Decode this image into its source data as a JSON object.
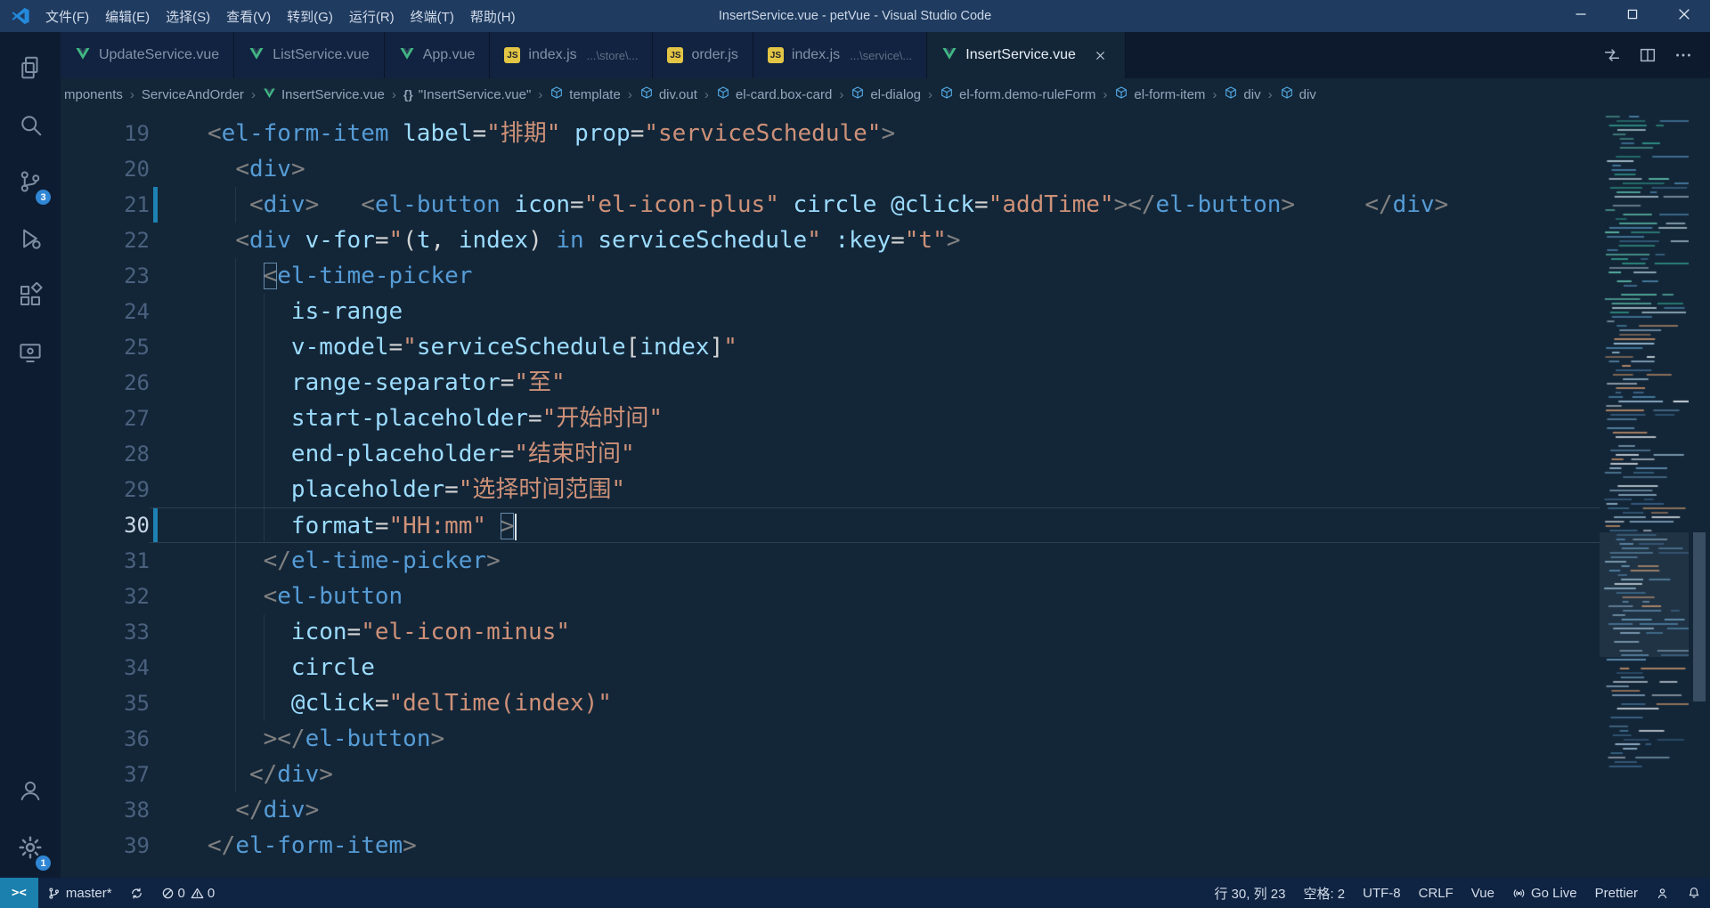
{
  "title_bar": {
    "title": "InsertService.vue - petVue - Visual Studio Code",
    "menus": [
      "文件(F)",
      "编辑(E)",
      "选择(S)",
      "查看(V)",
      "转到(G)",
      "运行(R)",
      "终端(T)",
      "帮助(H)"
    ],
    "window_controls": [
      {
        "name": "minimize-button",
        "icon": "minimize"
      },
      {
        "name": "maximize-button",
        "icon": "maximize"
      },
      {
        "name": "close-button",
        "icon": "close"
      }
    ]
  },
  "activity_bar": {
    "top": [
      {
        "name": "explorer",
        "icon": "explorer"
      },
      {
        "name": "search",
        "icon": "search"
      },
      {
        "name": "source-control",
        "icon": "scm",
        "badge": "3"
      },
      {
        "name": "run-debug",
        "icon": "debug"
      },
      {
        "name": "extensions",
        "icon": "extensions"
      },
      {
        "name": "remote-explorer",
        "icon": "remote"
      }
    ],
    "bottom": [
      {
        "name": "account",
        "icon": "account"
      },
      {
        "name": "settings",
        "icon": "gear",
        "badge": "1"
      }
    ]
  },
  "tabs": [
    {
      "label": "UpdateService.vue",
      "icon": "vue",
      "active": false
    },
    {
      "label": "ListService.vue",
      "icon": "vue",
      "active": false
    },
    {
      "label": "App.vue",
      "icon": "vue",
      "active": false
    },
    {
      "label": "index.js",
      "desc": "...\\store\\...",
      "icon": "js",
      "active": false
    },
    {
      "label": "order.js",
      "icon": "js",
      "active": false
    },
    {
      "label": "index.js",
      "desc": "...\\service\\...",
      "icon": "js",
      "active": false
    },
    {
      "label": "InsertService.vue",
      "icon": "vue",
      "active": true,
      "close": true
    }
  ],
  "tab_actions": [
    {
      "name": "open-changes-icon",
      "icon": "openchanges"
    },
    {
      "name": "split-editor-icon",
      "icon": "split"
    },
    {
      "name": "more-actions-icon",
      "icon": "ellipsis"
    }
  ],
  "breadcrumbs": [
    {
      "label": "mponents",
      "icon": null
    },
    {
      "label": "ServiceAndOrder",
      "icon": null
    },
    {
      "label": "InsertService.vue",
      "icon": "vue"
    },
    {
      "label": "\"InsertService.vue\"",
      "icon": "braces"
    },
    {
      "label": "template",
      "icon": "symbol"
    },
    {
      "label": "div.out",
      "icon": "symbol"
    },
    {
      "label": "el-card.box-card",
      "icon": "symbol"
    },
    {
      "label": "el-dialog",
      "icon": "symbol"
    },
    {
      "label": "el-form.demo-ruleForm",
      "icon": "symbol"
    },
    {
      "label": "el-form-item",
      "icon": "symbol"
    },
    {
      "label": "div",
      "icon": "symbol"
    },
    {
      "label": "div",
      "icon": "symbol"
    }
  ],
  "editor": {
    "lines": [
      {
        "num": 19,
        "indent": 0,
        "tokens": [
          [
            "p",
            "<"
          ],
          [
            "t",
            "el-form-item"
          ],
          [
            "w",
            " "
          ],
          [
            "a",
            "label"
          ],
          [
            "o",
            "="
          ],
          [
            "s",
            "\"排期\""
          ],
          [
            "w",
            " "
          ],
          [
            "a",
            "prop"
          ],
          [
            "o",
            "="
          ],
          [
            "s",
            "\"serviceSchedule\""
          ],
          [
            "p",
            ">"
          ]
        ]
      },
      {
        "num": 20,
        "indent": 2,
        "tokens": [
          [
            "p",
            "<"
          ],
          [
            "t",
            "div"
          ],
          [
            "p",
            ">"
          ]
        ]
      },
      {
        "num": 21,
        "indent": 3,
        "modified": true,
        "tokens": [
          [
            "p",
            "<"
          ],
          [
            "t",
            "div"
          ],
          [
            "p",
            ">"
          ],
          [
            "w",
            "   "
          ],
          [
            "p",
            "<"
          ],
          [
            "t",
            "el-button"
          ],
          [
            "w",
            " "
          ],
          [
            "a",
            "icon"
          ],
          [
            "o",
            "="
          ],
          [
            "s",
            "\"el-icon-plus\""
          ],
          [
            "w",
            " "
          ],
          [
            "a",
            "circle"
          ],
          [
            "w",
            " "
          ],
          [
            "a",
            "@click"
          ],
          [
            "o",
            "="
          ],
          [
            "s",
            "\"addTime\""
          ],
          [
            "p",
            "></"
          ],
          [
            "t",
            "el-button"
          ],
          [
            "p",
            ">"
          ],
          [
            "w",
            "     "
          ],
          [
            "p",
            "</"
          ],
          [
            "t",
            "div"
          ],
          [
            "p",
            ">"
          ]
        ]
      },
      {
        "num": 22,
        "indent": 2,
        "tokens": [
          [
            "p",
            "<"
          ],
          [
            "t",
            "div"
          ],
          [
            "w",
            " "
          ],
          [
            "a",
            "v-for"
          ],
          [
            "o",
            "="
          ],
          [
            "s",
            "\""
          ],
          [
            "w",
            "("
          ],
          [
            "a",
            "t"
          ],
          [
            "w",
            ", "
          ],
          [
            "a",
            "index"
          ],
          [
            "w",
            ") "
          ],
          [
            "k",
            "in"
          ],
          [
            "w",
            " "
          ],
          [
            "a",
            "serviceSchedule"
          ],
          [
            "s",
            "\""
          ],
          [
            "w",
            " "
          ],
          [
            "a",
            ":key"
          ],
          [
            "o",
            "="
          ],
          [
            "s",
            "\"t\""
          ],
          [
            "p",
            ">"
          ]
        ]
      },
      {
        "num": 23,
        "indent": 4,
        "tokens": [
          [
            "pm",
            "<"
          ],
          [
            "t",
            "el-time-picker"
          ]
        ]
      },
      {
        "num": 24,
        "indent": 6,
        "tokens": [
          [
            "a",
            "is-range"
          ]
        ]
      },
      {
        "num": 25,
        "indent": 6,
        "tokens": [
          [
            "a",
            "v-model"
          ],
          [
            "o",
            "="
          ],
          [
            "s",
            "\""
          ],
          [
            "a",
            "serviceSchedule"
          ],
          [
            "w",
            "["
          ],
          [
            "a",
            "index"
          ],
          [
            "w",
            "]"
          ],
          [
            "s",
            "\""
          ]
        ]
      },
      {
        "num": 26,
        "indent": 6,
        "tokens": [
          [
            "a",
            "range-separator"
          ],
          [
            "o",
            "="
          ],
          [
            "s",
            "\"至\""
          ]
        ]
      },
      {
        "num": 27,
        "indent": 6,
        "tokens": [
          [
            "a",
            "start-placeholder"
          ],
          [
            "o",
            "="
          ],
          [
            "s",
            "\"开始时间\""
          ]
        ]
      },
      {
        "num": 28,
        "indent": 6,
        "tokens": [
          [
            "a",
            "end-placeholder"
          ],
          [
            "o",
            "="
          ],
          [
            "s",
            "\"结束时间\""
          ]
        ]
      },
      {
        "num": 29,
        "indent": 6,
        "tokens": [
          [
            "a",
            "placeholder"
          ],
          [
            "o",
            "="
          ],
          [
            "s",
            "\"选择时间范围\""
          ]
        ]
      },
      {
        "num": 30,
        "indent": 6,
        "current": true,
        "modified": true,
        "cursor": true,
        "tokens": [
          [
            "a",
            "format"
          ],
          [
            "o",
            "="
          ],
          [
            "s",
            "\"HH:mm\""
          ],
          [
            "w",
            " "
          ],
          [
            "pm",
            ">"
          ]
        ]
      },
      {
        "num": 31,
        "indent": 4,
        "tokens": [
          [
            "p",
            "</"
          ],
          [
            "t",
            "el-time-picker"
          ],
          [
            "p",
            ">"
          ]
        ]
      },
      {
        "num": 32,
        "indent": 4,
        "tokens": [
          [
            "p",
            "<"
          ],
          [
            "t",
            "el-button"
          ]
        ]
      },
      {
        "num": 33,
        "indent": 6,
        "tokens": [
          [
            "a",
            "icon"
          ],
          [
            "o",
            "="
          ],
          [
            "s",
            "\"el-icon-minus\""
          ]
        ]
      },
      {
        "num": 34,
        "indent": 6,
        "tokens": [
          [
            "a",
            "circle"
          ]
        ]
      },
      {
        "num": 35,
        "indent": 6,
        "tokens": [
          [
            "a",
            "@click"
          ],
          [
            "o",
            "="
          ],
          [
            "s",
            "\"delTime(index)\""
          ]
        ]
      },
      {
        "num": 36,
        "indent": 4,
        "tokens": [
          [
            "p",
            "></"
          ],
          [
            "t",
            "el-button"
          ],
          [
            "p",
            ">"
          ]
        ]
      },
      {
        "num": 37,
        "indent": 3,
        "tokens": [
          [
            "p",
            "</"
          ],
          [
            "t",
            "div"
          ],
          [
            "p",
            ">"
          ]
        ]
      },
      {
        "num": 38,
        "indent": 2,
        "tokens": [
          [
            "p",
            "</"
          ],
          [
            "t",
            "div"
          ],
          [
            "p",
            ">"
          ]
        ]
      },
      {
        "num": 39,
        "indent": 0,
        "tokens": [
          [
            "p",
            "</"
          ],
          [
            "t",
            "el-form-item"
          ],
          [
            "p",
            ">"
          ]
        ]
      }
    ]
  },
  "status_bar": {
    "remote_glyph": "><",
    "branch": "master*",
    "problems": {
      "errors": "0",
      "warnings": "0"
    },
    "right": [
      {
        "name": "cursor-position",
        "label": "行 30, 列 23"
      },
      {
        "name": "indentation",
        "label": "空格: 2"
      },
      {
        "name": "encoding",
        "label": "UTF-8"
      },
      {
        "name": "eol",
        "label": "CRLF"
      },
      {
        "name": "language-mode",
        "label": "Vue"
      },
      {
        "name": "go-live",
        "icon": "broadcast",
        "label": "Go Live"
      },
      {
        "name": "prettier",
        "label": "Prettier"
      },
      {
        "name": "feedback",
        "icon": "feedback",
        "label": ""
      },
      {
        "name": "notifications",
        "icon": "bell",
        "label": ""
      }
    ]
  },
  "colors": {
    "accent": "#2f86d4",
    "titlebar": "#1f3b60",
    "editor_bg": "#132638",
    "remote_bg": "#1b80ad",
    "tag": "#569cd6",
    "attribute": "#9cdcfe",
    "string": "#ce9178",
    "punctuation": "#808080"
  }
}
